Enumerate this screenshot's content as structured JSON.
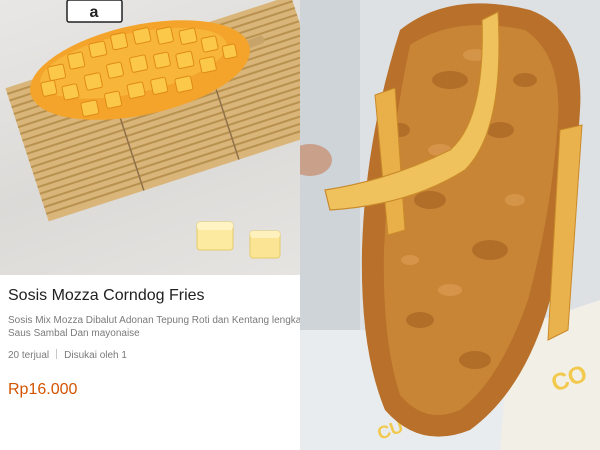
{
  "product": {
    "title": "Sosis Mozza Corndog Fries",
    "description_line1": "Sosis Mix Mozza Dibalut Adonan Tepung Roti dan Kentang lengkap",
    "description_line2": "Saus Sambal Dan mayonaise",
    "sold": "20 terjual",
    "liked": "Disukai oleh 1",
    "price": "Rp16.000"
  },
  "colors": {
    "price": "#d35400",
    "title": "#212121",
    "muted": "#7a7a7a"
  }
}
